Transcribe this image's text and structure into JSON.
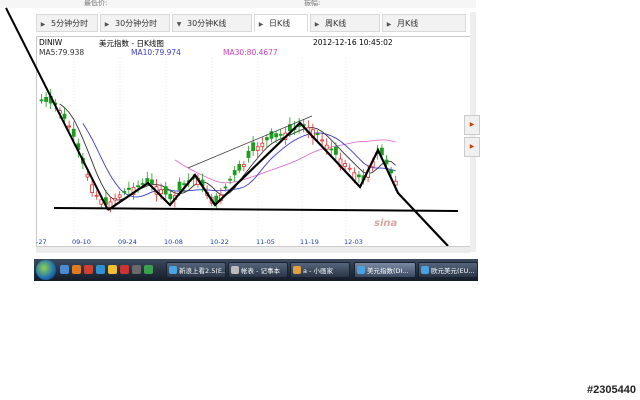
{
  "topbar": {
    "left_text": "最低价:",
    "right_text": "振幅:"
  },
  "tabs": [
    {
      "label": "5分钟分时",
      "active": false
    },
    {
      "label": "30分钟分时",
      "active": false
    },
    {
      "label": "30分钟K线",
      "active": false
    },
    {
      "label": "日K线",
      "active": true
    },
    {
      "label": "周K线",
      "active": false
    },
    {
      "label": "月K线",
      "active": false
    }
  ],
  "chart_header": {
    "symbol": "DINIW",
    "title": "美元指数 - 日K线图",
    "datetime": "2012-12-16 10:45:02",
    "ma5": "MA5:79.938",
    "ma10": "MA10:79.974",
    "ma30": "MA30:80.4677"
  },
  "chart_data": {
    "type": "candlestick",
    "title": "美元指数 - 日K线图",
    "x_tick_labels": [
      "-27",
      "09-10",
      "09-24",
      "10-08",
      "10-22",
      "11-05",
      "11-19",
      "12-03"
    ],
    "legend": [
      "MA5:79.938",
      "MA10:79.974",
      "MA30:80.4677"
    ],
    "series_colors": {
      "up": "#e03030",
      "down": "#1f9c1f",
      "ma5": "#333333",
      "ma10": "#3a3ad0",
      "ma30": "#e070d0"
    }
  },
  "colors": {
    "accent": "#1a3cb3",
    "up": "#e03030",
    "down": "#1f9c1f"
  },
  "logo_text": "sina",
  "taskbar": {
    "tasks": [
      {
        "label": "新浪上看2.5(E...",
        "active": false
      },
      {
        "label": "帐表 - 记事本",
        "active": false
      },
      {
        "label": "a - 小画家",
        "active": false
      },
      {
        "label": "美元指数(DI...",
        "active": true
      },
      {
        "label": "欧元美元(EU...",
        "active": false
      }
    ]
  },
  "watermark": "#2305440"
}
